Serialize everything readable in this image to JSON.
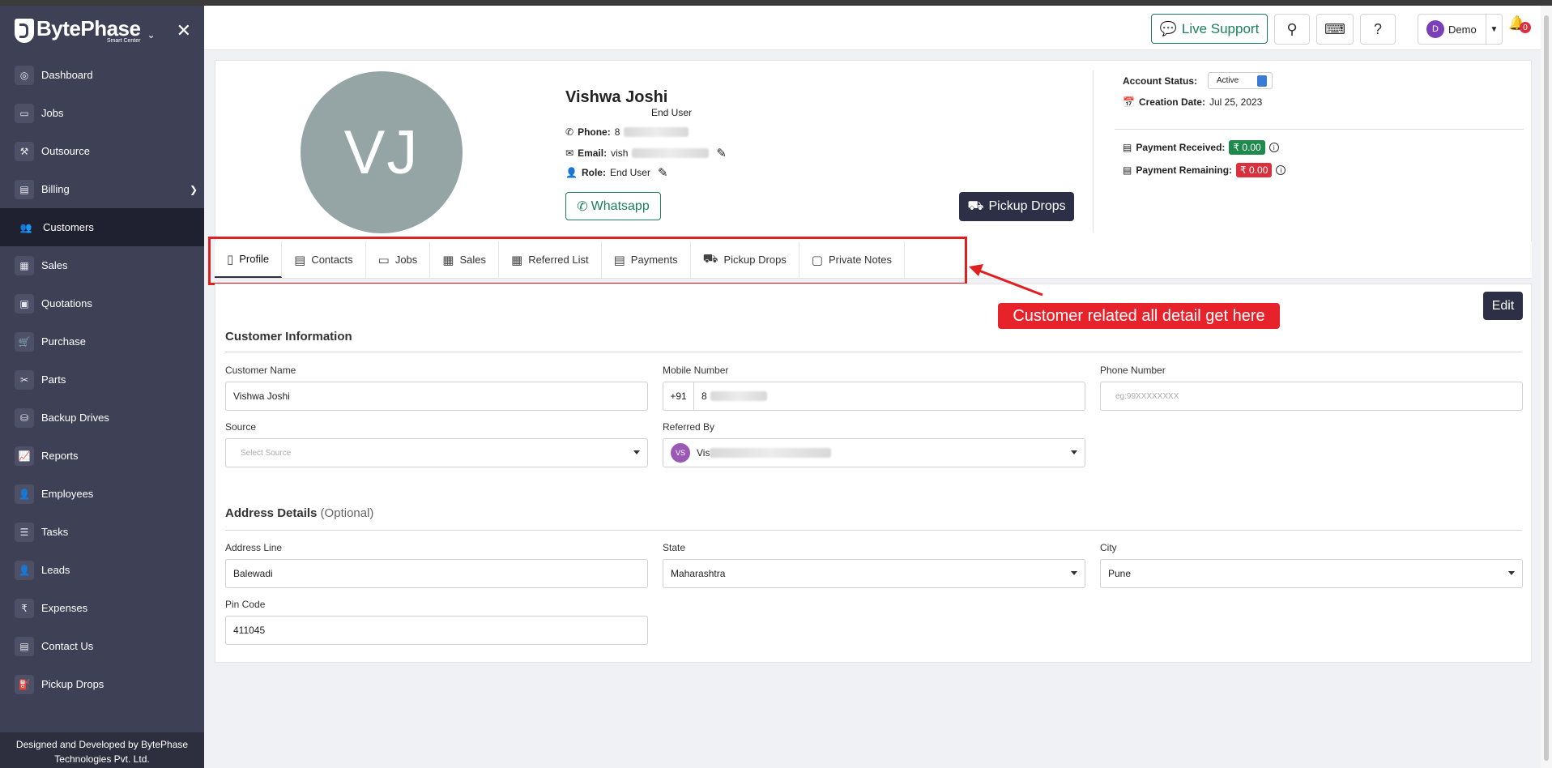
{
  "brand": {
    "name": "BytePhase",
    "sub": "Smart Center"
  },
  "sidebar": {
    "items": [
      {
        "label": "Dashboard",
        "icon": "dashboard-icon",
        "glyph": "◎"
      },
      {
        "label": "Jobs",
        "icon": "jobs-icon",
        "glyph": "▭"
      },
      {
        "label": "Outsource",
        "icon": "outsource-icon",
        "glyph": "⚒"
      },
      {
        "label": "Billing",
        "icon": "billing-icon",
        "glyph": "▤"
      },
      {
        "label": "Customers",
        "icon": "customers-icon",
        "glyph": "👥"
      },
      {
        "label": "Sales",
        "icon": "sales-icon",
        "glyph": "▦"
      },
      {
        "label": "Quotations",
        "icon": "quotations-icon",
        "glyph": "▣"
      },
      {
        "label": "Purchase",
        "icon": "purchase-icon",
        "glyph": "🛒"
      },
      {
        "label": "Parts",
        "icon": "parts-icon",
        "glyph": "✂"
      },
      {
        "label": "Backup Drives",
        "icon": "backup-drives-icon",
        "glyph": "⛁"
      },
      {
        "label": "Reports",
        "icon": "reports-icon",
        "glyph": "📈"
      },
      {
        "label": "Employees",
        "icon": "employees-icon",
        "glyph": "👤"
      },
      {
        "label": "Tasks",
        "icon": "tasks-icon",
        "glyph": "☰"
      },
      {
        "label": "Leads",
        "icon": "leads-icon",
        "glyph": "👤"
      },
      {
        "label": "Expenses",
        "icon": "expenses-icon",
        "glyph": "₹"
      },
      {
        "label": "Contact Us",
        "icon": "contact-us-icon",
        "glyph": "▤"
      },
      {
        "label": "Pickup Drops",
        "icon": "pickup-drops-icon",
        "glyph": "⛽"
      }
    ],
    "active": "Customers",
    "footer_line1": "Designed and Developed by BytePhase",
    "footer_line2": "Technologies Pvt. Ltd."
  },
  "header": {
    "live_support": "Live Support",
    "user_initial": "D",
    "user_name": "Demo",
    "notif_count": "0"
  },
  "profile": {
    "initials": "VJ",
    "name": "Vishwa Joshi",
    "subtitle": "End User",
    "phone_label": "Phone:",
    "phone_value": "8",
    "email_label": "Email:",
    "email_value": "vish",
    "role_label": "Role:",
    "role_value": "End User",
    "whatsapp": "Whatsapp",
    "pickup_drops": "Pickup Drops"
  },
  "status": {
    "account_status_label": "Account Status:",
    "account_status_value": "Active",
    "creation_date_label": "Creation Date:",
    "creation_date_value": "Jul 25, 2023",
    "payment_received_label": "Payment Received:",
    "payment_received_value": "₹ 0.00",
    "payment_remaining_label": "Payment Remaining:",
    "payment_remaining_value": "₹ 0.00",
    "received_color": "#1e8a4c",
    "remaining_color": "#d9303d"
  },
  "tabs": [
    {
      "label": "Profile",
      "icon": "profile-tab-icon",
      "glyph": "▯"
    },
    {
      "label": "Contacts",
      "icon": "contacts-tab-icon",
      "glyph": "▤"
    },
    {
      "label": "Jobs",
      "icon": "jobs-tab-icon",
      "glyph": "▭"
    },
    {
      "label": "Sales",
      "icon": "sales-tab-icon",
      "glyph": "▦"
    },
    {
      "label": "Referred List",
      "icon": "referred-list-tab-icon",
      "glyph": "▦"
    },
    {
      "label": "Payments",
      "icon": "payments-tab-icon",
      "glyph": "▤"
    },
    {
      "label": "Pickup Drops",
      "icon": "pickup-drops-tab-icon",
      "glyph": "⛟"
    },
    {
      "label": "Private Notes",
      "icon": "private-notes-tab-icon",
      "glyph": "▢"
    }
  ],
  "annotation": "Customer related all detail get here",
  "detail": {
    "edit": "Edit",
    "customer_info_title": "Customer Information",
    "customer_name_label": "Customer Name",
    "customer_name_value": "Vishwa Joshi",
    "mobile_label": "Mobile Number",
    "mobile_prefix": "+91",
    "mobile_value": "8",
    "phone_label": "Phone Number",
    "phone_placeholder": "eg:99XXXXXXXX",
    "source_label": "Source",
    "source_placeholder": "Select Source",
    "referred_by_label": "Referred By",
    "referred_by_initials": "VS",
    "referred_by_value": "Vis",
    "address_title": "Address Details",
    "address_optional": "(Optional)",
    "address_line_label": "Address Line",
    "address_line_value": "Balewadi",
    "state_label": "State",
    "state_value": "Maharashtra",
    "city_label": "City",
    "city_value": "Pune",
    "pincode_label": "Pin Code",
    "pincode_value": "411045"
  }
}
